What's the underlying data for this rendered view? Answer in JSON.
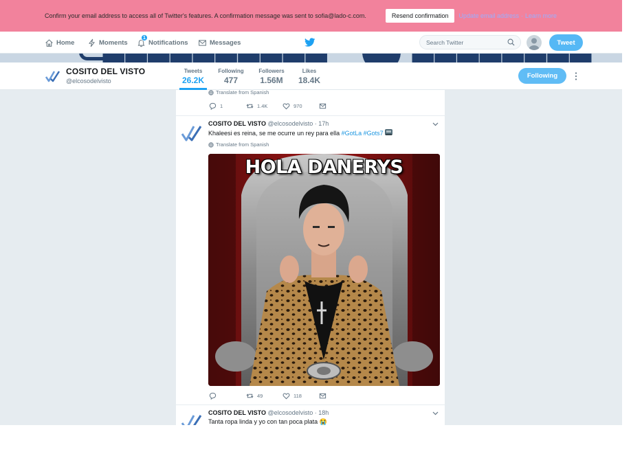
{
  "banner": {
    "message_prefix": "Confirm your email address to access all of Twitter's features. A confirmation message was sent to ",
    "email": "sofia@lado-c.com",
    "message_suffix": ".",
    "resend_label": "Resend confirmation",
    "update_link": "Update email address",
    "separator": "·",
    "learn_more": "Learn more"
  },
  "nav": {
    "home": "Home",
    "moments": "Moments",
    "notifications": "Notifications",
    "notifications_count": "1",
    "messages": "Messages",
    "search_placeholder": "Search Twitter",
    "tweet_button": "Tweet"
  },
  "profile": {
    "name": "COSITO DEL VISTO",
    "handle": "@elcosodelvisto",
    "stats": [
      {
        "label": "Tweets",
        "value": "26.2K",
        "active": true
      },
      {
        "label": "Following",
        "value": "477"
      },
      {
        "label": "Followers",
        "value": "1.56M"
      },
      {
        "label": "Likes",
        "value": "18.4K"
      }
    ],
    "following_button": "Following"
  },
  "tweets": [
    {
      "translate": "Translate from Spanish",
      "actions": {
        "replies": "1",
        "retweets": "1.4K",
        "likes": "970"
      }
    },
    {
      "name": "COSITO DEL VISTO",
      "handle_time": "@elcosodelvisto · 17h",
      "text": "Khaleesi es reina, se me ocurre un rey para ella ",
      "hashtags": [
        "#GotLa",
        "#Gots7"
      ],
      "translate": "Translate from Spanish",
      "image_caption": "HOLA DANERYS",
      "actions": {
        "replies": "",
        "retweets": "49",
        "likes": "118"
      }
    },
    {
      "name": "COSITO DEL VISTO",
      "handle_time": "@elcosodelvisto · 18h",
      "text": "Tanta ropa linda y yo con tan poca plata 😭"
    }
  ],
  "colors": {
    "banner_bg": "#f2829c",
    "accent": "#1da1f2",
    "page_bg": "#e6ecf0"
  }
}
